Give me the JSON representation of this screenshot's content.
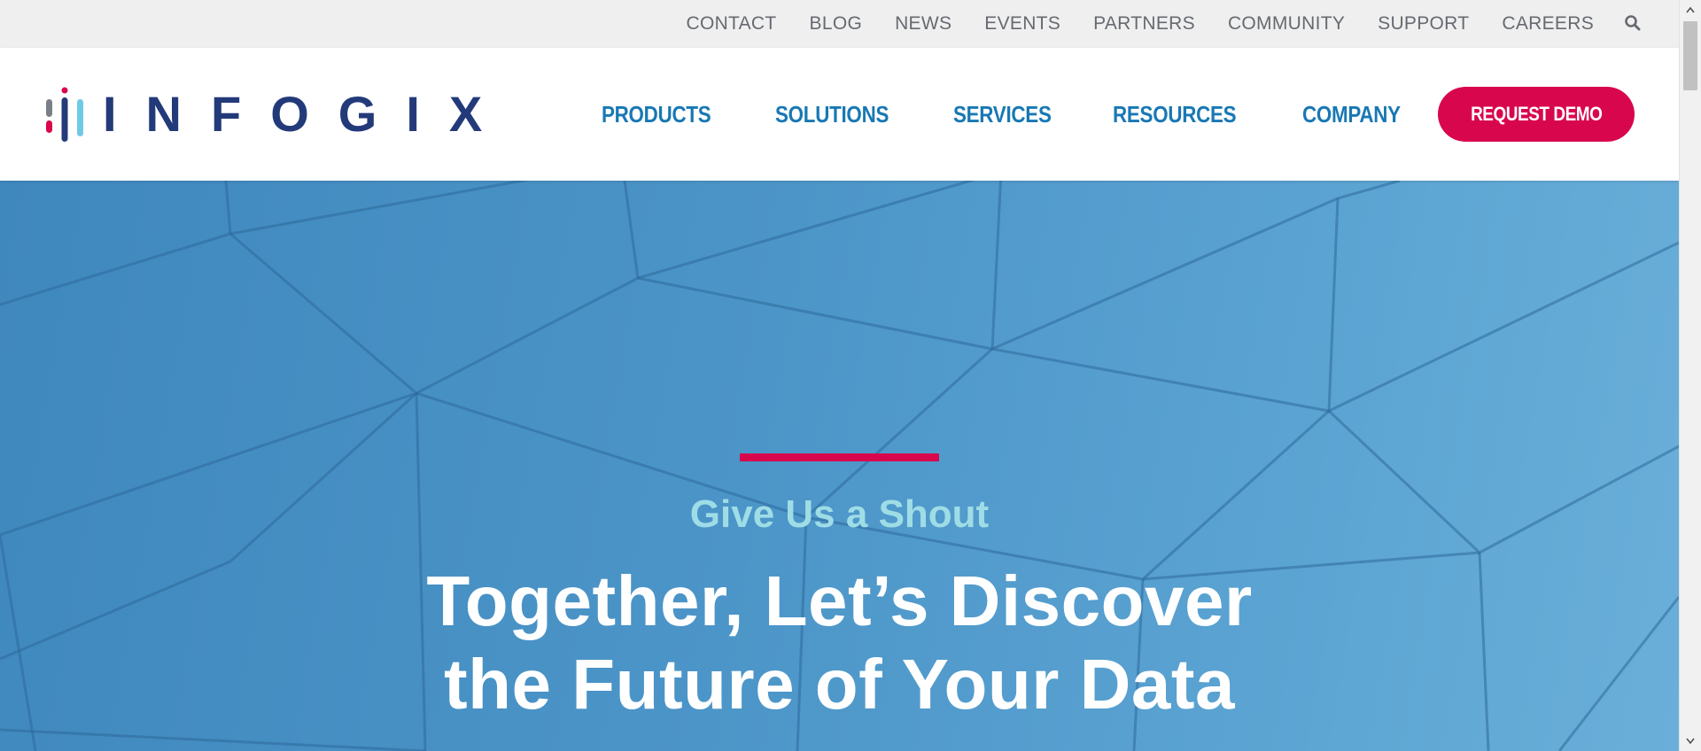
{
  "utility_nav": {
    "links": [
      "CONTACT",
      "BLOG",
      "NEWS",
      "EVENTS",
      "PARTNERS",
      "COMMUNITY",
      "SUPPORT",
      "CAREERS"
    ],
    "search_icon": "search-icon"
  },
  "header": {
    "logo_text": "INFOGIX",
    "nav": [
      "PRODUCTS",
      "SOLUTIONS",
      "SERVICES",
      "RESOURCES",
      "COMPANY"
    ],
    "demo_button": "REQUEST DEMO"
  },
  "hero": {
    "eyebrow": "Give Us a Shout",
    "heading_line1": "Together, Let’s Discover",
    "heading_line2": "the Future of Your Data"
  },
  "colors": {
    "brand_navy": "#233a7a",
    "nav_blue": "#1878b4",
    "accent_red": "#d8074d",
    "eyebrow_teal": "#9fdde6"
  }
}
